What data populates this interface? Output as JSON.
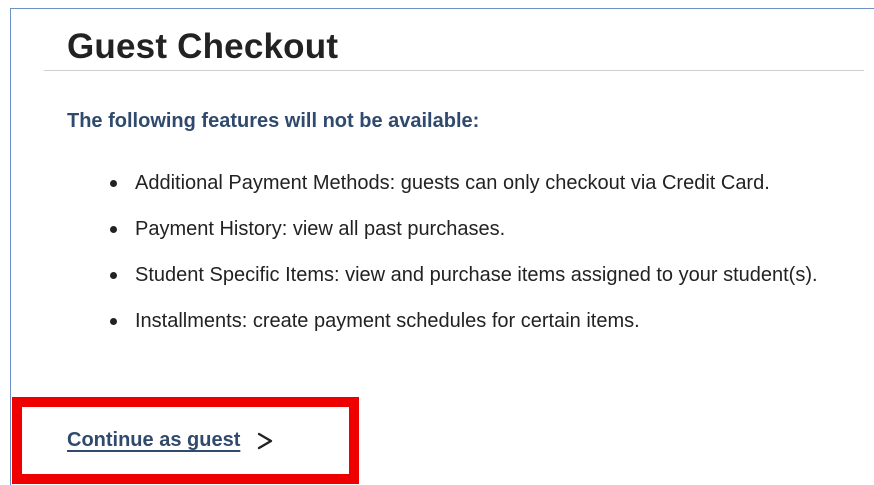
{
  "panel": {
    "title": "Guest Checkout",
    "subtitle": "The following features will not be available:",
    "features": [
      "Additional Payment Methods: guests can only checkout via Credit Card.",
      "Payment History: view all past purchases.",
      "Student Specific Items: view and purchase items assigned to your student(s).",
      "Installments: create payment schedules for certain items."
    ],
    "continue_label": "Continue as guest"
  },
  "colors": {
    "accent_text": "#2f4a6d",
    "highlight_border": "#ee0000",
    "frame_border": "#6f8fc7"
  },
  "icons": {
    "continue_arrow": "chevron-right-icon",
    "list_bullet": "bullet-icon"
  }
}
